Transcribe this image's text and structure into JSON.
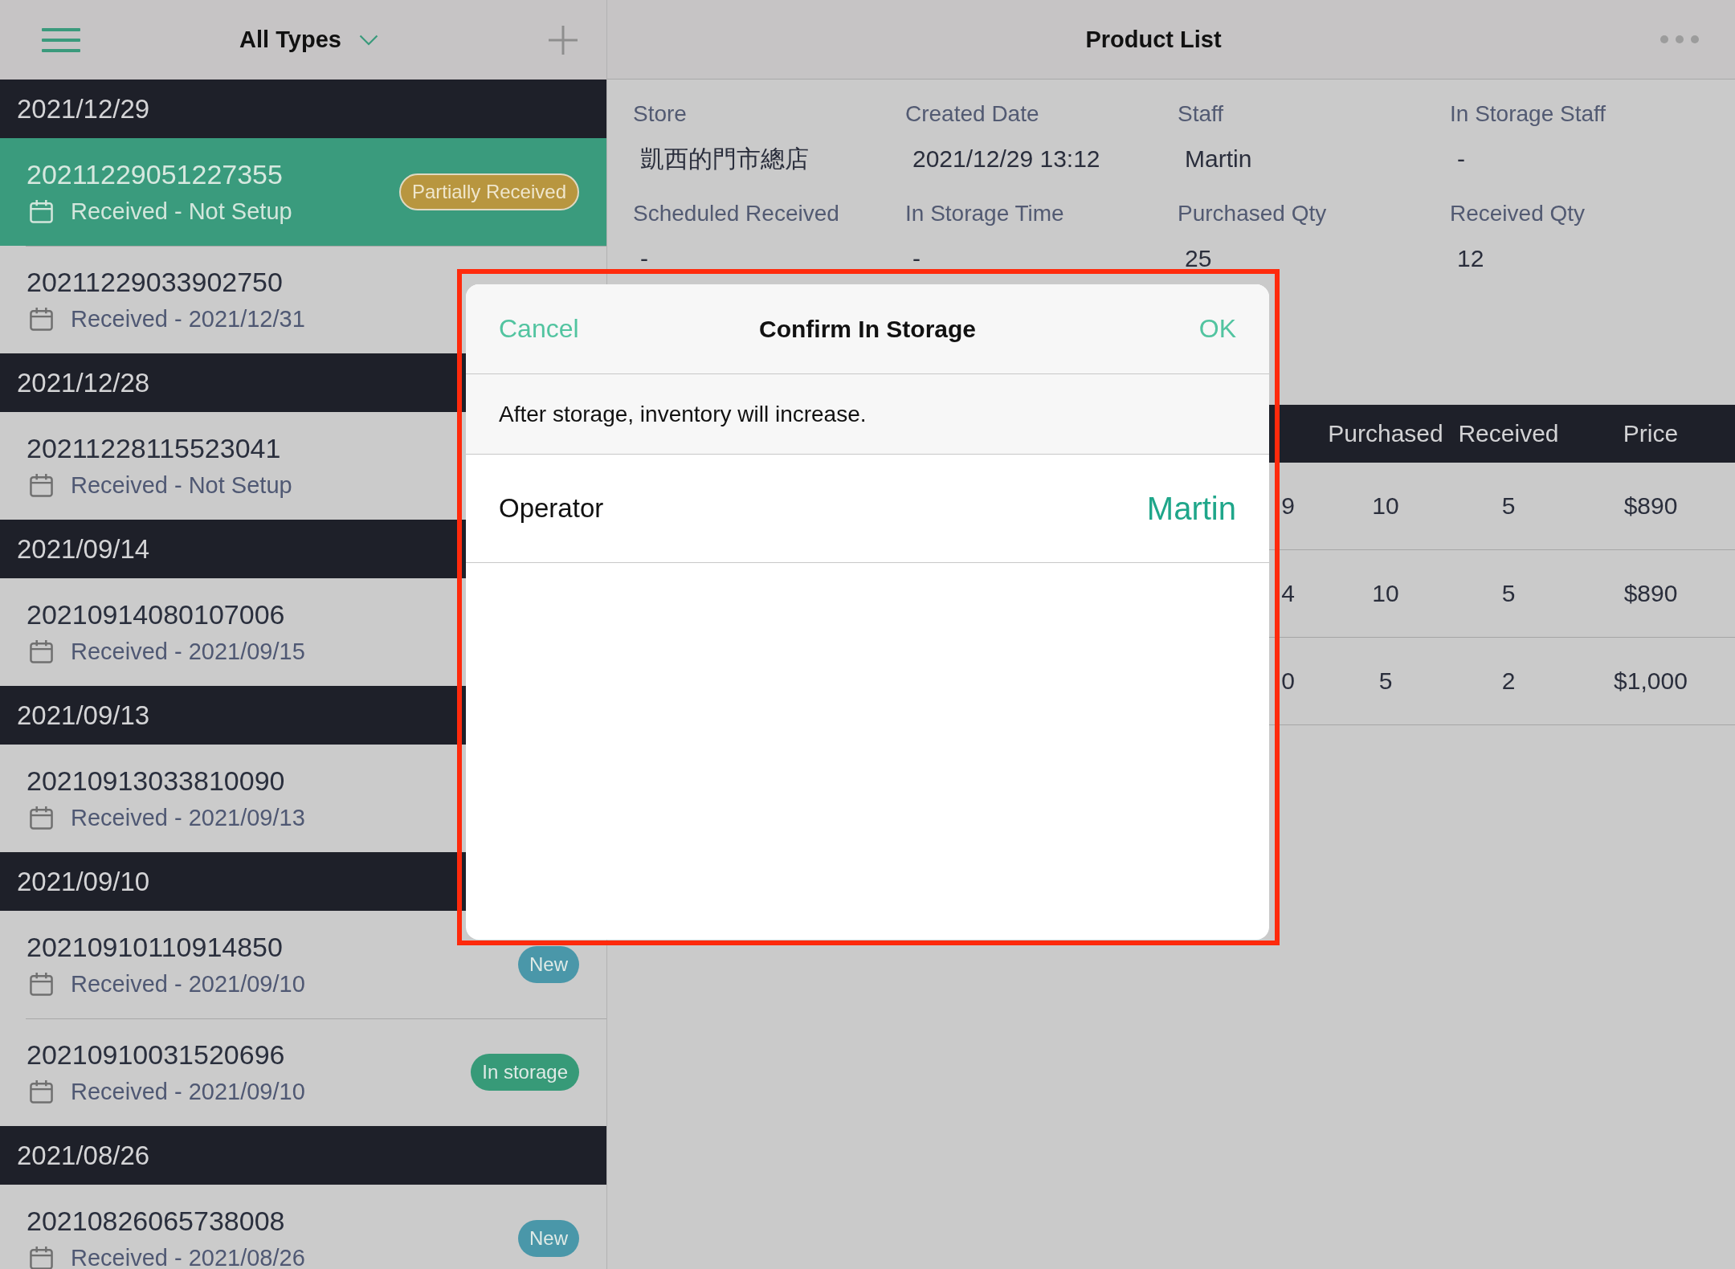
{
  "sidebar": {
    "filter": "All Types",
    "groups": [
      {
        "date": "2021/12/29",
        "orders": [
          {
            "number": "20211229051227355",
            "received": "Received - Not Setup",
            "selected": true,
            "badge": {
              "label": "Partially Received",
              "color": "#b8963f"
            }
          },
          {
            "number": "20211229033902750",
            "received": "Received - 2021/12/31",
            "selected": false
          }
        ]
      },
      {
        "date": "2021/12/28",
        "orders": [
          {
            "number": "20211228115523041",
            "received": "Received - Not Setup",
            "selected": false
          }
        ]
      },
      {
        "date": "2021/09/14",
        "orders": [
          {
            "number": "20210914080107006",
            "received": "Received - 2021/09/15",
            "selected": false
          }
        ]
      },
      {
        "date": "2021/09/13",
        "orders": [
          {
            "number": "20210913033810090",
            "received": "Received - 2021/09/13",
            "selected": false
          }
        ]
      },
      {
        "date": "2021/09/10",
        "orders": [
          {
            "number": "20210910110914850",
            "received": "Received - 2021/09/10",
            "selected": false,
            "badge": {
              "label": "New",
              "color": "#4a97a9"
            }
          },
          {
            "number": "20210910031520696",
            "received": "Received - 2021/09/10",
            "selected": false,
            "badge": {
              "label": "In storage",
              "color": "#379a78"
            }
          }
        ]
      },
      {
        "date": "2021/08/26",
        "orders": [
          {
            "number": "20210826065738008",
            "received": "Received - 2021/08/26",
            "selected": false,
            "badge": {
              "label": "New",
              "color": "#4a97a9"
            }
          }
        ]
      }
    ]
  },
  "detail": {
    "title": "Product List",
    "fields": [
      {
        "label": "Store",
        "value": "凱西的門市總店"
      },
      {
        "label": "Created Date",
        "value": "2021/12/29 13:12"
      },
      {
        "label": "Staff",
        "value": "Martin"
      },
      {
        "label": "In Storage Staff",
        "value": "-"
      },
      {
        "label": "Scheduled Received",
        "value": "-"
      },
      {
        "label": "In Storage Time",
        "value": "-"
      },
      {
        "label": "Purchased Qty",
        "value": "25"
      },
      {
        "label": "Received Qty",
        "value": "12"
      }
    ],
    "table": {
      "columns": [
        "Purchased",
        "Received",
        "Price"
      ],
      "rows": [
        {
          "column_1": "9",
          "cells": [
            "10",
            "5",
            "$890"
          ]
        },
        {
          "column_1": "4",
          "cells": [
            "10",
            "5",
            "$890"
          ]
        },
        {
          "column_1": "0",
          "cells": [
            "5",
            "2",
            "$1,000"
          ]
        }
      ]
    }
  },
  "dialog": {
    "cancel": "Cancel",
    "title": "Confirm In Storage",
    "ok": "OK",
    "message": "After storage, inventory will increase.",
    "operator_label": "Operator",
    "operator": "Martin"
  }
}
